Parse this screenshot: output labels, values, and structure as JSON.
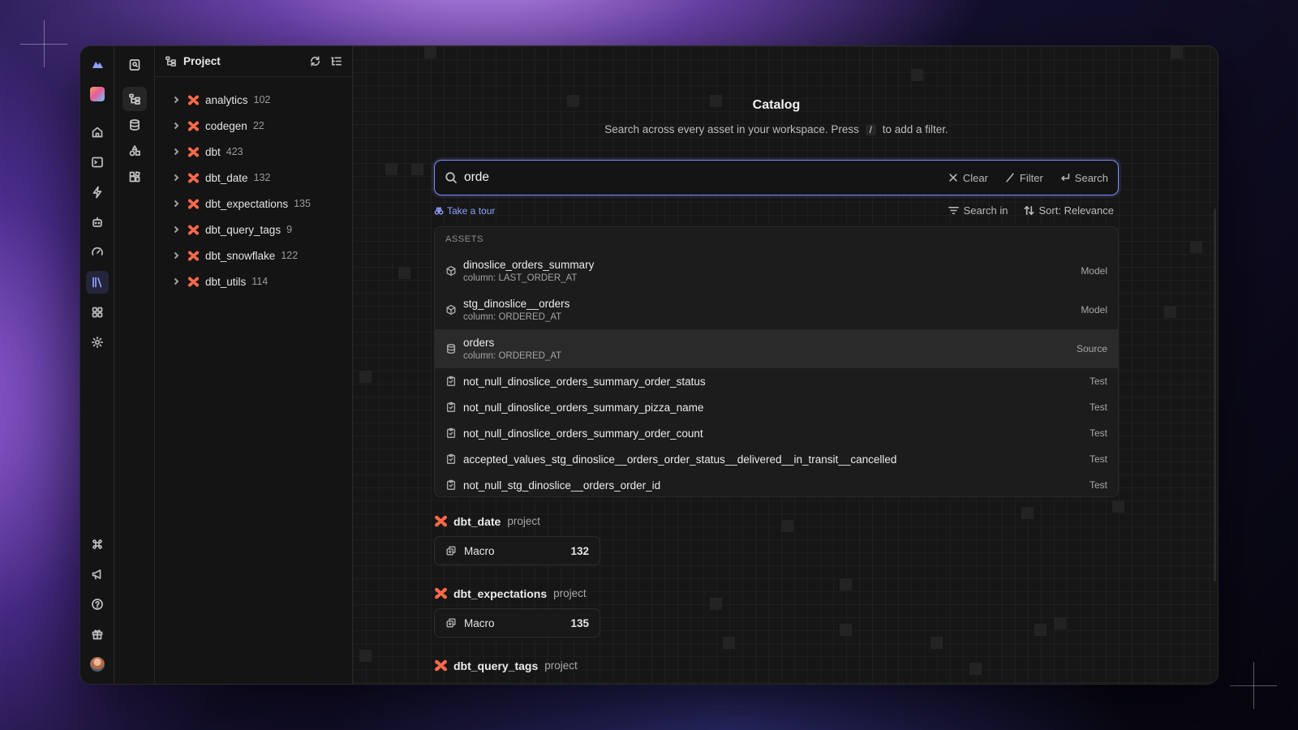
{
  "colors": {
    "accent": "#8da2ff",
    "dbt_orange": "#ff694a",
    "background": "#161616"
  },
  "rail": {
    "top": [
      "cloud-logo",
      "workspace-avatar",
      "home-icon",
      "terminal-icon",
      "bolt-icon",
      "robot-icon",
      "gauge-icon",
      "library-icon",
      "grid-icon",
      "gear-icon"
    ],
    "bottom": [
      "command-icon",
      "megaphone-icon",
      "help-icon",
      "gift-icon",
      "user-avatar"
    ],
    "active": "library-icon"
  },
  "rail2": {
    "items": [
      "search-panel-icon",
      "tree-icon",
      "database-icon",
      "shapes-icon",
      "blocks-icon"
    ],
    "active": "tree-icon"
  },
  "tree": {
    "title": "Project",
    "items": [
      {
        "name": "analytics",
        "count": "102"
      },
      {
        "name": "codegen",
        "count": "22"
      },
      {
        "name": "dbt",
        "count": "423"
      },
      {
        "name": "dbt_date",
        "count": "132"
      },
      {
        "name": "dbt_expectations",
        "count": "135"
      },
      {
        "name": "dbt_query_tags",
        "count": "9"
      },
      {
        "name": "dbt_snowflake",
        "count": "122"
      },
      {
        "name": "dbt_utils",
        "count": "114"
      }
    ]
  },
  "catalog": {
    "title": "Catalog",
    "subtitle_before": "Search across every asset in your workspace. Press",
    "subtitle_key": "/",
    "subtitle_after": "to add a filter."
  },
  "search": {
    "query": "orde",
    "clear": "Clear",
    "filter": "Filter",
    "submit": "Search"
  },
  "tour": "Take a tour",
  "options": {
    "search_in": "Search in",
    "sort": "Sort: Relevance"
  },
  "results": {
    "section": "ASSETS",
    "items": [
      {
        "name": "dinoslice_orders_summary",
        "sub": "column: LAST_ORDER_AT",
        "type": "Model",
        "icon": "cube-icon"
      },
      {
        "name": "stg_dinoslice__orders",
        "sub": "column: ORDERED_AT",
        "type": "Model",
        "icon": "cube-icon"
      },
      {
        "name": "orders",
        "sub": "column: ORDERED_AT",
        "type": "Source",
        "icon": "database-icon",
        "selected": true
      },
      {
        "name": "not_null_dinoslice_orders_summary_order_status",
        "type": "Test",
        "icon": "clipboard-icon"
      },
      {
        "name": "not_null_dinoslice_orders_summary_pizza_name",
        "type": "Test",
        "icon": "clipboard-icon"
      },
      {
        "name": "not_null_dinoslice_orders_summary_order_count",
        "type": "Test",
        "icon": "clipboard-icon"
      },
      {
        "name": "accepted_values_stg_dinoslice__orders_order_status__delivered__in_transit__cancelled",
        "type": "Test",
        "icon": "clipboard-icon"
      },
      {
        "name": "not_null_stg_dinoslice__orders_order_id",
        "type": "Test",
        "icon": "clipboard-icon"
      }
    ]
  },
  "projects": [
    {
      "name": "dbt_date",
      "tag": "project",
      "card_label": "Macro",
      "card_count": "132"
    },
    {
      "name": "dbt_expectations",
      "tag": "project",
      "card_label": "Macro",
      "card_count": "135"
    },
    {
      "name": "dbt_query_tags",
      "tag": "project"
    }
  ]
}
